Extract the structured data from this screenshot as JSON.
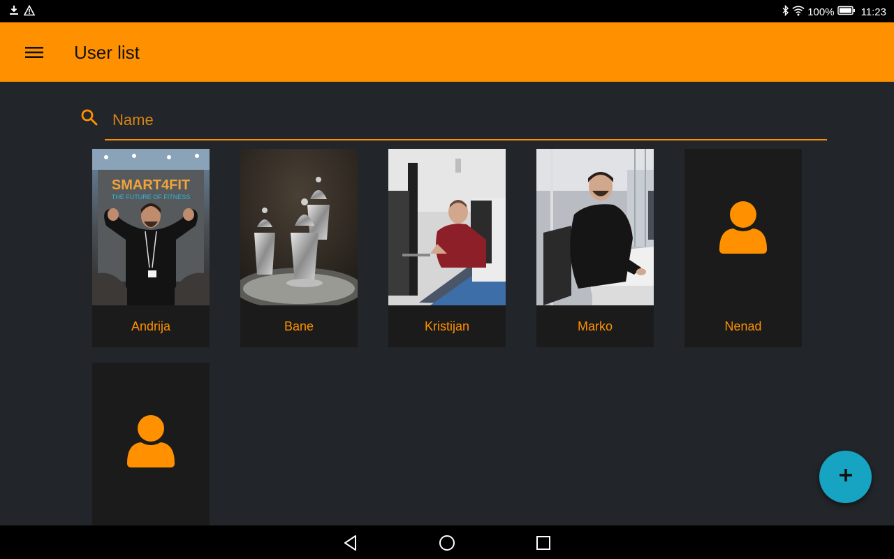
{
  "status_bar": {
    "icons_left": [
      "download-icon",
      "warning-icon"
    ],
    "icons_right": [
      "bluetooth-icon",
      "wifi-icon",
      "battery-icon"
    ],
    "battery": "100%",
    "time": "11:23"
  },
  "app_bar": {
    "menu_icon": "hamburger-menu-icon",
    "title": "User list",
    "background": "#ff9100"
  },
  "search": {
    "icon": "search-icon",
    "placeholder": "Name",
    "value": ""
  },
  "users": [
    {
      "name": "Andrija",
      "has_photo": true,
      "photo": "man flexing arms in front of Smart4Fit banner",
      "banner_text": "SMART4FIT",
      "banner_subtext": "THE FUTURE OF FITNESS"
    },
    {
      "name": "Bane",
      "has_photo": true,
      "photo": "silver Turkish tea glasses on tray"
    },
    {
      "name": "Kristijan",
      "has_photo": true,
      "photo": "man at desk in office"
    },
    {
      "name": "Marko",
      "has_photo": true,
      "photo": "man in black sweater in office"
    },
    {
      "name": "Nenad",
      "has_photo": false,
      "placeholder_icon": "user-placeholder-icon"
    },
    {
      "name": "",
      "has_photo": false,
      "placeholder_icon": "user-placeholder-icon"
    }
  ],
  "fab": {
    "icon": "plus-icon",
    "color": "#17a3c2"
  },
  "nav_bar": {
    "icons": [
      "back-icon",
      "home-icon",
      "recents-icon"
    ]
  },
  "colors": {
    "accent": "#ff9100",
    "background": "#222529",
    "card": "#1b1b1b"
  }
}
